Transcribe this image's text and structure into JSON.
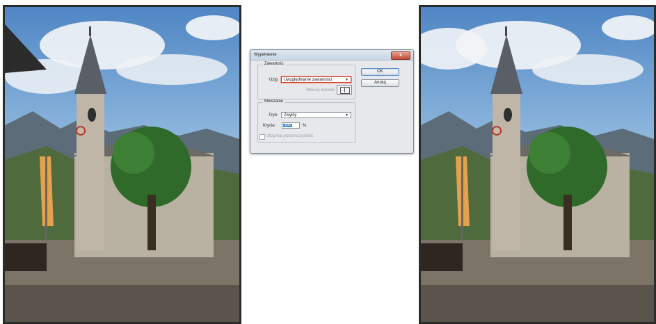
{
  "dialog": {
    "title": "Wypełnienie",
    "close_label": "x",
    "contents_group": {
      "legend": "Zawartość",
      "use_label": "Użyj:",
      "use_value": "Uwzględnianie zawartości",
      "custom_pattern_label": "Własny wzorek:"
    },
    "blending_group": {
      "legend": "Mieszanie",
      "mode_label": "Tryb:",
      "mode_value": "Zwykły",
      "opacity_label": "Krycie:",
      "opacity_value": "100",
      "opacity_unit": "%",
      "preserve_transparency_label": "Utrzymaj przezroczystość",
      "preserve_transparency_checked": false
    },
    "ok_label": "OK",
    "cancel_label": "Anuluj"
  },
  "images": [
    {
      "name": "before-photo",
      "description_icon": "church-landscape-image"
    },
    {
      "name": "after-photo",
      "description_icon": "church-landscape-image"
    }
  ],
  "colors": {
    "accent_red": "#d23a25",
    "selection_blue": "#4a8fd8"
  }
}
